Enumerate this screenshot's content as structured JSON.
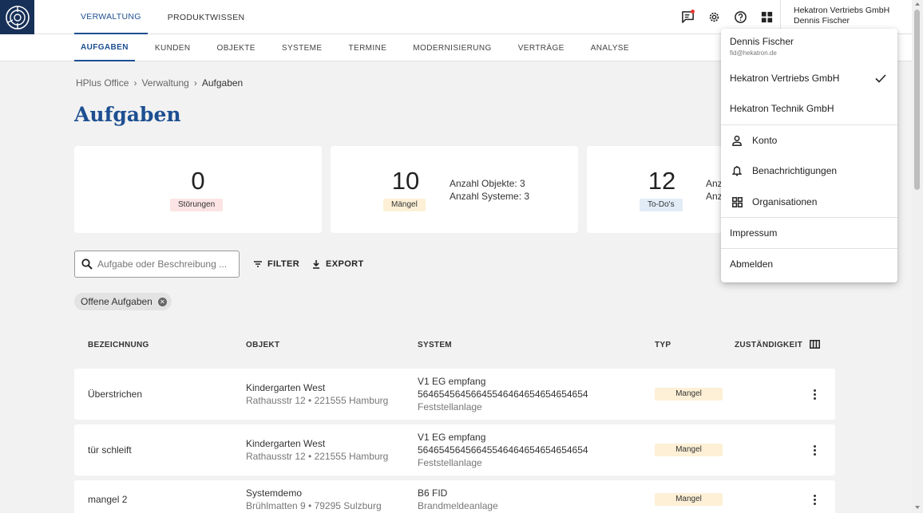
{
  "colors": {
    "primary": "#1d4f91",
    "logo_bg": "#173057",
    "badge_stoerungen": "#fde4e4",
    "badge_maengel": "#fdf0d6",
    "badge_todos": "#e1ecf7",
    "type_badge": "#fdf0d6",
    "notification_dot": "#e53935"
  },
  "topnav": {
    "items": [
      {
        "label": "VERWALTUNG",
        "active": true
      },
      {
        "label": "PRODUKTWISSEN",
        "active": false
      }
    ],
    "icons": [
      "feedback-icon",
      "settings-icon",
      "help-icon",
      "apps-icon"
    ],
    "org_line1": "Hekatron Vertriebs GmbH",
    "org_line2": "Dennis Fischer"
  },
  "subnav": {
    "items": [
      {
        "label": "AUFGABEN",
        "active": true
      },
      {
        "label": "KUNDEN"
      },
      {
        "label": "OBJEKTE"
      },
      {
        "label": "SYSTEME"
      },
      {
        "label": "TERMINE"
      },
      {
        "label": "MODERNISIERUNG"
      },
      {
        "label": "VERTRÄGE"
      },
      {
        "label": "ANALYSE"
      }
    ]
  },
  "breadcrumb": [
    "HPlus Office",
    "Verwaltung",
    "Aufgaben"
  ],
  "page_title": "Aufgaben",
  "stats": {
    "stoerungen": {
      "value": "0",
      "label": "Störungen"
    },
    "maengel": {
      "value": "10",
      "label": "Mängel",
      "info1": "Anzahl Objekte: 3",
      "info2": "Anzahl Systeme: 3"
    },
    "todos": {
      "value": "12",
      "label": "To-Do's",
      "info1": "Anz",
      "info2": "Anz"
    }
  },
  "toolbar": {
    "search_placeholder": "Aufgabe oder Beschreibung ...",
    "filter_label": "FILTER",
    "export_label": "EXPORT"
  },
  "chip": {
    "label": "Offene Aufgaben"
  },
  "table": {
    "headers": {
      "bezeichnung": "BEZEICHNUNG",
      "objekt": "OBJEKT",
      "system": "SYSTEM",
      "typ": "TYP",
      "zustaendigkeit": "ZUSTÄNDIGKEIT"
    },
    "rows": [
      {
        "bezeichnung": "Überstrichen",
        "objekt_name": "Kindergarten West",
        "objekt_adresse": "Rathausstr 12 • 221555 Hamburg",
        "system_name": "V1 EG empfang",
        "system_id": "5646545645664554646465465465465​4",
        "system_typ": "Feststellanlage",
        "typ": "Mangel"
      },
      {
        "bezeichnung": "tür schleift",
        "objekt_name": "Kindergarten West",
        "objekt_adresse": "Rathausstr 12 • 221555 Hamburg",
        "system_name": "V1 EG empfang",
        "system_id": "5646545645664554646465465465465​4",
        "system_typ": "Feststellanlage",
        "typ": "Mangel"
      },
      {
        "bezeichnung": "mangel 2",
        "objekt_name": "Systemdemo",
        "objekt_adresse": "Brühlmatten 9 • 79295 Sulzburg",
        "system_name": "B6 FID",
        "system_id": "",
        "system_typ": "Brandmeldeanlage",
        "typ": "Mangel"
      }
    ]
  },
  "menu": {
    "user_name": "Dennis Fischer",
    "user_email": "fid@hekatron.de",
    "org1": "Hekatron Vertriebs GmbH",
    "org2": "Hekatron Technik GmbH",
    "konto": "Konto",
    "benachrichtigungen": "Benachrichtigungen",
    "organisationen": "Organisationen",
    "impressum": "Impressum",
    "abmelden": "Abmelden"
  }
}
